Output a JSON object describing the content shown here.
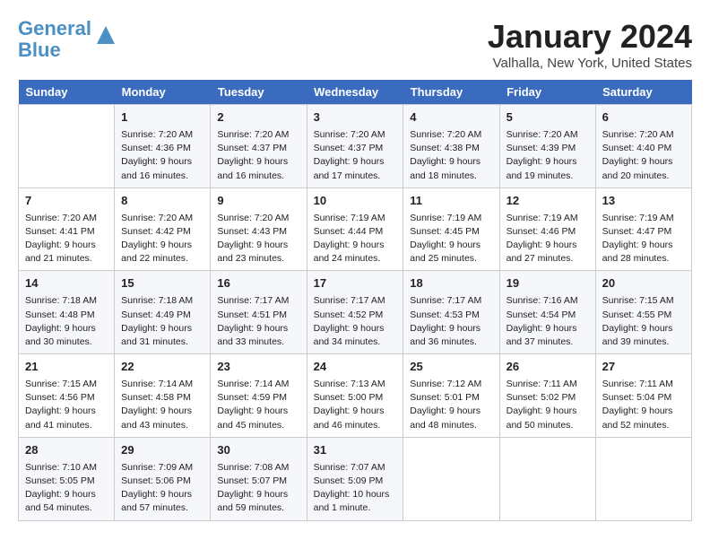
{
  "header": {
    "logo_line1": "General",
    "logo_line2": "Blue",
    "month_title": "January 2024",
    "location": "Valhalla, New York, United States"
  },
  "days_of_week": [
    "Sunday",
    "Monday",
    "Tuesday",
    "Wednesday",
    "Thursday",
    "Friday",
    "Saturday"
  ],
  "weeks": [
    [
      {
        "day": "",
        "content": ""
      },
      {
        "day": "1",
        "content": "Sunrise: 7:20 AM\nSunset: 4:36 PM\nDaylight: 9 hours and 16 minutes."
      },
      {
        "day": "2",
        "content": "Sunrise: 7:20 AM\nSunset: 4:37 PM\nDaylight: 9 hours and 16 minutes."
      },
      {
        "day": "3",
        "content": "Sunrise: 7:20 AM\nSunset: 4:37 PM\nDaylight: 9 hours and 17 minutes."
      },
      {
        "day": "4",
        "content": "Sunrise: 7:20 AM\nSunset: 4:38 PM\nDaylight: 9 hours and 18 minutes."
      },
      {
        "day": "5",
        "content": "Sunrise: 7:20 AM\nSunset: 4:39 PM\nDaylight: 9 hours and 19 minutes."
      },
      {
        "day": "6",
        "content": "Sunrise: 7:20 AM\nSunset: 4:40 PM\nDaylight: 9 hours and 20 minutes."
      }
    ],
    [
      {
        "day": "7",
        "content": "Sunrise: 7:20 AM\nSunset: 4:41 PM\nDaylight: 9 hours and 21 minutes."
      },
      {
        "day": "8",
        "content": "Sunrise: 7:20 AM\nSunset: 4:42 PM\nDaylight: 9 hours and 22 minutes."
      },
      {
        "day": "9",
        "content": "Sunrise: 7:20 AM\nSunset: 4:43 PM\nDaylight: 9 hours and 23 minutes."
      },
      {
        "day": "10",
        "content": "Sunrise: 7:19 AM\nSunset: 4:44 PM\nDaylight: 9 hours and 24 minutes."
      },
      {
        "day": "11",
        "content": "Sunrise: 7:19 AM\nSunset: 4:45 PM\nDaylight: 9 hours and 25 minutes."
      },
      {
        "day": "12",
        "content": "Sunrise: 7:19 AM\nSunset: 4:46 PM\nDaylight: 9 hours and 27 minutes."
      },
      {
        "day": "13",
        "content": "Sunrise: 7:19 AM\nSunset: 4:47 PM\nDaylight: 9 hours and 28 minutes."
      }
    ],
    [
      {
        "day": "14",
        "content": "Sunrise: 7:18 AM\nSunset: 4:48 PM\nDaylight: 9 hours and 30 minutes."
      },
      {
        "day": "15",
        "content": "Sunrise: 7:18 AM\nSunset: 4:49 PM\nDaylight: 9 hours and 31 minutes."
      },
      {
        "day": "16",
        "content": "Sunrise: 7:17 AM\nSunset: 4:51 PM\nDaylight: 9 hours and 33 minutes."
      },
      {
        "day": "17",
        "content": "Sunrise: 7:17 AM\nSunset: 4:52 PM\nDaylight: 9 hours and 34 minutes."
      },
      {
        "day": "18",
        "content": "Sunrise: 7:17 AM\nSunset: 4:53 PM\nDaylight: 9 hours and 36 minutes."
      },
      {
        "day": "19",
        "content": "Sunrise: 7:16 AM\nSunset: 4:54 PM\nDaylight: 9 hours and 37 minutes."
      },
      {
        "day": "20",
        "content": "Sunrise: 7:15 AM\nSunset: 4:55 PM\nDaylight: 9 hours and 39 minutes."
      }
    ],
    [
      {
        "day": "21",
        "content": "Sunrise: 7:15 AM\nSunset: 4:56 PM\nDaylight: 9 hours and 41 minutes."
      },
      {
        "day": "22",
        "content": "Sunrise: 7:14 AM\nSunset: 4:58 PM\nDaylight: 9 hours and 43 minutes."
      },
      {
        "day": "23",
        "content": "Sunrise: 7:14 AM\nSunset: 4:59 PM\nDaylight: 9 hours and 45 minutes."
      },
      {
        "day": "24",
        "content": "Sunrise: 7:13 AM\nSunset: 5:00 PM\nDaylight: 9 hours and 46 minutes."
      },
      {
        "day": "25",
        "content": "Sunrise: 7:12 AM\nSunset: 5:01 PM\nDaylight: 9 hours and 48 minutes."
      },
      {
        "day": "26",
        "content": "Sunrise: 7:11 AM\nSunset: 5:02 PM\nDaylight: 9 hours and 50 minutes."
      },
      {
        "day": "27",
        "content": "Sunrise: 7:11 AM\nSunset: 5:04 PM\nDaylight: 9 hours and 52 minutes."
      }
    ],
    [
      {
        "day": "28",
        "content": "Sunrise: 7:10 AM\nSunset: 5:05 PM\nDaylight: 9 hours and 54 minutes."
      },
      {
        "day": "29",
        "content": "Sunrise: 7:09 AM\nSunset: 5:06 PM\nDaylight: 9 hours and 57 minutes."
      },
      {
        "day": "30",
        "content": "Sunrise: 7:08 AM\nSunset: 5:07 PM\nDaylight: 9 hours and 59 minutes."
      },
      {
        "day": "31",
        "content": "Sunrise: 7:07 AM\nSunset: 5:09 PM\nDaylight: 10 hours and 1 minute."
      },
      {
        "day": "",
        "content": ""
      },
      {
        "day": "",
        "content": ""
      },
      {
        "day": "",
        "content": ""
      }
    ]
  ]
}
